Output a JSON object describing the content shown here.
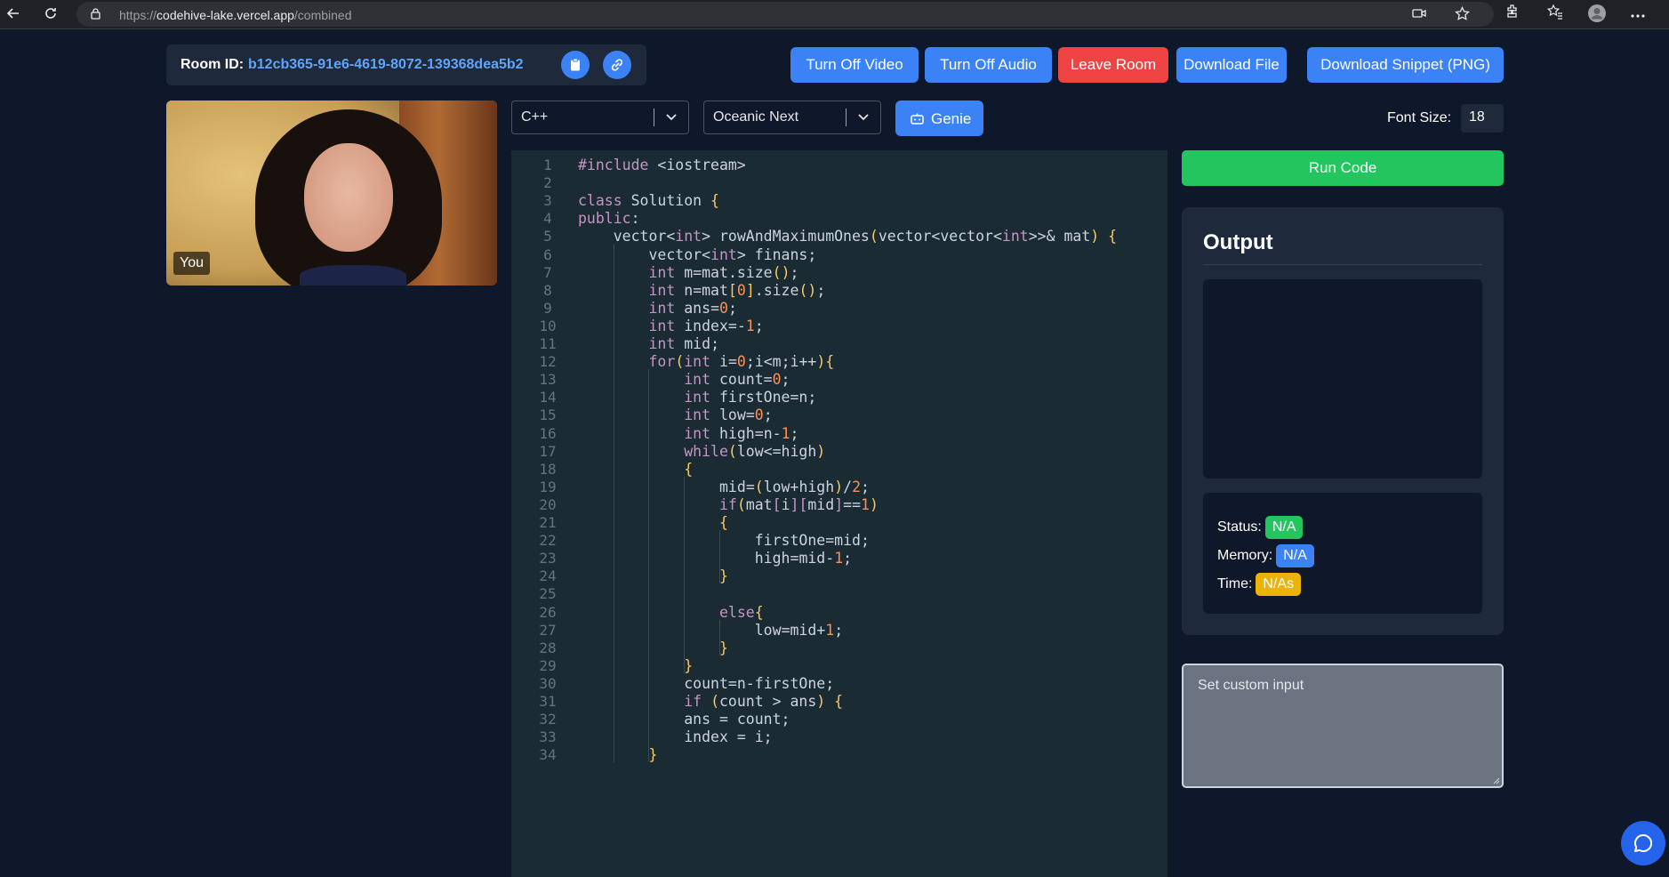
{
  "browser": {
    "url_prefix": "https://",
    "url_host": "codehive-lake.vercel.app",
    "url_path": "/combined"
  },
  "room": {
    "label": "Room ID:",
    "id": "b12cb365-91e6-4619-8072-139368dea5b2"
  },
  "toolbar": {
    "video": "Turn Off Video",
    "audio": "Turn Off Audio",
    "leave": "Leave Room",
    "download_file": "Download File",
    "download_snippet": "Download Snippet (PNG)"
  },
  "video": {
    "label": "You"
  },
  "editor_settings": {
    "language": "C++",
    "theme": "Oceanic Next",
    "genie": "Genie",
    "font_size_label": "Font Size:",
    "font_size": "18"
  },
  "code_lines": [
    "#include <iostream>",
    "",
    "class Solution {",
    "public:",
    "    vector<int> rowAndMaximumOnes(vector<vector<int>>& mat) {",
    "        vector<int> finans;",
    "        int m=mat.size();",
    "        int n=mat[0].size();",
    "        int ans=0;",
    "        int index=-1;",
    "        int mid;",
    "        for(int i=0;i<m;i++){",
    "            int count=0;",
    "            int firstOne=n;",
    "            int low=0;",
    "            int high=n-1;",
    "            while(low<=high)",
    "            {",
    "                mid=(low+high)/2;",
    "                if(mat[i][mid]==1)",
    "                {",
    "                    firstOne=mid;",
    "                    high=mid-1;",
    "                }",
    "",
    "                else{",
    "                    low=mid+1;",
    "                }",
    "            }",
    "            count=n-firstOne;",
    "            if (count > ans) {",
    "            ans = count;",
    "            index = i;",
    "        }"
  ],
  "line_numbers": [
    "1",
    "2",
    "3",
    "4",
    "5",
    "6",
    "7",
    "8",
    "9",
    "10",
    "11",
    "12",
    "13",
    "14",
    "15",
    "16",
    "17",
    "18",
    "19",
    "20",
    "21",
    "22",
    "23",
    "24",
    "25",
    "26",
    "27",
    "28",
    "29",
    "30",
    "31",
    "32",
    "33",
    "34"
  ],
  "run": {
    "label": "Run Code"
  },
  "output": {
    "title": "Output",
    "status_label": "Status:",
    "status_value": "N/A",
    "memory_label": "Memory:",
    "memory_value": "N/A",
    "time_label": "Time:",
    "time_value": "N/As"
  },
  "custom_input": {
    "placeholder": "Set custom input"
  },
  "colors": {
    "accent": "#3b82f6",
    "danger": "#ef4444",
    "success": "#22c55e",
    "warning": "#eab308",
    "editor_bg": "#1b2b34"
  },
  "icons": [
    "back-icon",
    "reload-icon",
    "lock-icon",
    "camera-icon",
    "star-icon",
    "extensions-icon",
    "favorites-icon",
    "profile-icon",
    "more-icon",
    "clipboard-icon",
    "link-icon",
    "chevron-down-icon",
    "robot-icon",
    "resize-grip-icon",
    "chat-icon"
  ]
}
